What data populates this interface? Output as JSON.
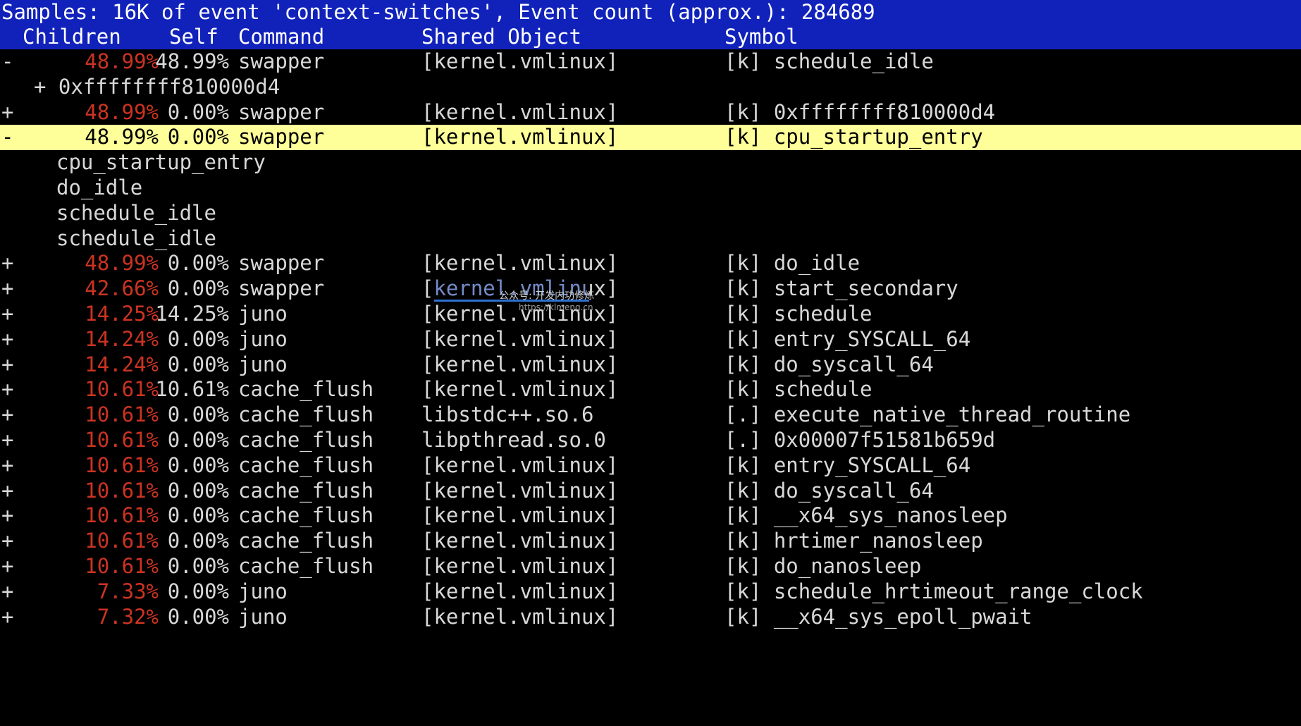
{
  "app": {
    "name": "perf-report-tui"
  },
  "header": {
    "title": "Samples: 16K of event 'context-switches', Event count (approx.): 284689",
    "samples": "16K",
    "event_name": "context-switches",
    "event_count": "284689",
    "columns": {
      "children": "Children",
      "self": "Self",
      "command": "Command",
      "shared_object": "Shared Object",
      "symbol": "Symbol"
    },
    "colors": {
      "background": "#1122bb",
      "text": "#ffffff"
    }
  },
  "theme": {
    "background": "#000000",
    "text": "#d8d8d8",
    "percent_red": "#cc3322",
    "selected_background": "#ffff99",
    "selected_text": "#000000",
    "link_blue": "#2f6fd0"
  },
  "rows": [
    {
      "kind": "entry",
      "sign": "-",
      "children": "48.99%",
      "self": "48.99%",
      "command": "swapper",
      "shared_object": "[kernel.vmlinux]",
      "symbol": "[k] schedule_idle",
      "selected": false
    },
    {
      "kind": "callchain-branch",
      "stack": "+ 0xffffffff810000d4"
    },
    {
      "kind": "entry",
      "sign": "+",
      "children": "48.99%",
      "self": "0.00%",
      "command": "swapper",
      "shared_object": "[kernel.vmlinux]",
      "symbol": "[k] 0xffffffff810000d4",
      "selected": false
    },
    {
      "kind": "entry",
      "sign": "-",
      "children": "48.99%",
      "self": "0.00%",
      "command": "swapper",
      "shared_object": "[kernel.vmlinux]",
      "symbol": "[k] cpu_startup_entry",
      "selected": true
    },
    {
      "kind": "callchain",
      "stack": "cpu_startup_entry"
    },
    {
      "kind": "callchain",
      "stack": "do_idle"
    },
    {
      "kind": "callchain",
      "stack": "schedule_idle"
    },
    {
      "kind": "callchain",
      "stack": "schedule_idle"
    },
    {
      "kind": "entry",
      "sign": "+",
      "children": "48.99%",
      "self": "0.00%",
      "command": "swapper",
      "shared_object": "[kernel.vmlinux]",
      "symbol": "[k] do_idle",
      "selected": false
    },
    {
      "kind": "entry",
      "sign": "+",
      "children": "42.66%",
      "self": "0.00%",
      "command": "swapper",
      "shared_object": "[kernel.vmlinux]",
      "symbol": "[k] start_secondary",
      "selected": false
    },
    {
      "kind": "entry",
      "sign": "+",
      "children": "14.25%",
      "self": "14.25%",
      "command": "juno",
      "shared_object": "[kernel.vmlinux]",
      "symbol": "[k] schedule",
      "selected": false
    },
    {
      "kind": "entry",
      "sign": "+",
      "children": "14.24%",
      "self": "0.00%",
      "command": "juno",
      "shared_object": "[kernel.vmlinux]",
      "symbol": "[k] entry_SYSCALL_64",
      "selected": false
    },
    {
      "kind": "entry",
      "sign": "+",
      "children": "14.24%",
      "self": "0.00%",
      "command": "juno",
      "shared_object": "[kernel.vmlinux]",
      "symbol": "[k] do_syscall_64",
      "selected": false
    },
    {
      "kind": "entry",
      "sign": "+",
      "children": "10.61%",
      "self": "10.61%",
      "command": "cache_flush",
      "shared_object": "[kernel.vmlinux]",
      "symbol": "[k] schedule",
      "selected": false
    },
    {
      "kind": "entry",
      "sign": "+",
      "children": "10.61%",
      "self": "0.00%",
      "command": "cache_flush",
      "shared_object": "libstdc++.so.6",
      "symbol": "[.] execute_native_thread_routine",
      "selected": false
    },
    {
      "kind": "entry",
      "sign": "+",
      "children": "10.61%",
      "self": "0.00%",
      "command": "cache_flush",
      "shared_object": "libpthread.so.0",
      "symbol": "[.] 0x00007f51581b659d",
      "selected": false
    },
    {
      "kind": "entry",
      "sign": "+",
      "children": "10.61%",
      "self": "0.00%",
      "command": "cache_flush",
      "shared_object": "[kernel.vmlinux]",
      "symbol": "[k] entry_SYSCALL_64",
      "selected": false
    },
    {
      "kind": "entry",
      "sign": "+",
      "children": "10.61%",
      "self": "0.00%",
      "command": "cache_flush",
      "shared_object": "[kernel.vmlinux]",
      "symbol": "[k] do_syscall_64",
      "selected": false
    },
    {
      "kind": "entry",
      "sign": "+",
      "children": "10.61%",
      "self": "0.00%",
      "command": "cache_flush",
      "shared_object": "[kernel.vmlinux]",
      "symbol": "[k] __x64_sys_nanosleep",
      "selected": false
    },
    {
      "kind": "entry",
      "sign": "+",
      "children": "10.61%",
      "self": "0.00%",
      "command": "cache_flush",
      "shared_object": "[kernel.vmlinux]",
      "symbol": "[k] hrtimer_nanosleep",
      "selected": false
    },
    {
      "kind": "entry",
      "sign": "+",
      "children": "10.61%",
      "self": "0.00%",
      "command": "cache_flush",
      "shared_object": "[kernel.vmlinux]",
      "symbol": "[k] do_nanosleep",
      "selected": false
    },
    {
      "kind": "entry",
      "sign": "+",
      "children": "7.33%",
      "self": "0.00%",
      "command": "juno",
      "shared_object": "[kernel.vmlinux]",
      "symbol": "[k] schedule_hrtimeout_range_clock",
      "selected": false
    },
    {
      "kind": "entry",
      "sign": "+",
      "children": "7.32%",
      "self": "0.00%",
      "command": "juno",
      "shared_object": "[kernel.vmlinux]",
      "symbol": "[k] __x64_sys_epoll_pwait",
      "selected": false
    }
  ],
  "watermark": {
    "line1": "公众号: 开发内功修炼",
    "line2": "https://klmeng.cn"
  }
}
